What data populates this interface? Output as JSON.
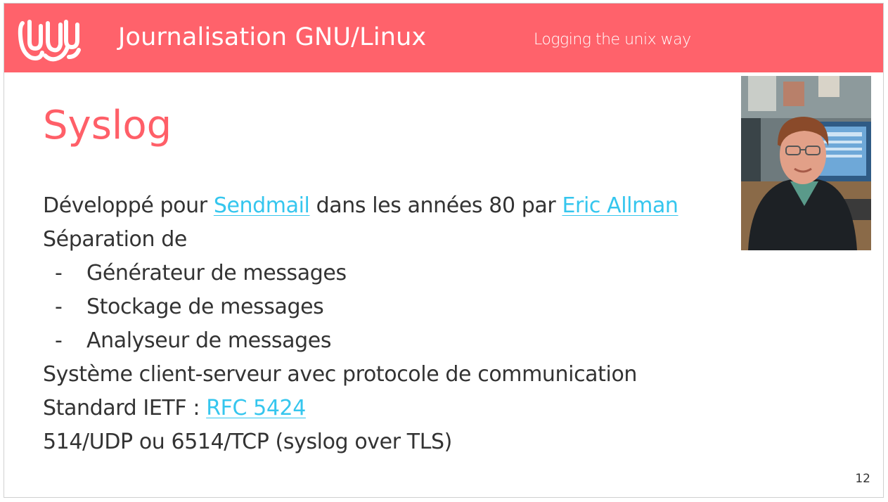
{
  "header": {
    "title": "Journalisation GNU/Linux",
    "subtitle": "Logging the unix way",
    "logo_icon": "wave-logo-icon",
    "background_color": "#ff626b"
  },
  "slide": {
    "title": "Syslog",
    "title_color": "#ff5f68",
    "page_number": "12",
    "photo_icon": "portrait-photo",
    "link_color": "#35c6ee"
  },
  "content": {
    "line1": {
      "prefix": "Développé pour ",
      "link1": "Sendmail",
      "middle": " dans les années 80 par ",
      "link2": "Eric Allman"
    },
    "line2": "Séparation de",
    "bullets": [
      {
        "dash": "-",
        "text": "Générateur de messages"
      },
      {
        "dash": "-",
        "text": "Stockage de messages"
      },
      {
        "dash": "-",
        "text": "Analyseur de messages"
      }
    ],
    "line3": "Système client-serveur avec protocole de communication",
    "line4": {
      "prefix": "Standard IETF : ",
      "link": "RFC 5424"
    },
    "line5": "514/UDP ou 6514/TCP (syslog over TLS)"
  }
}
